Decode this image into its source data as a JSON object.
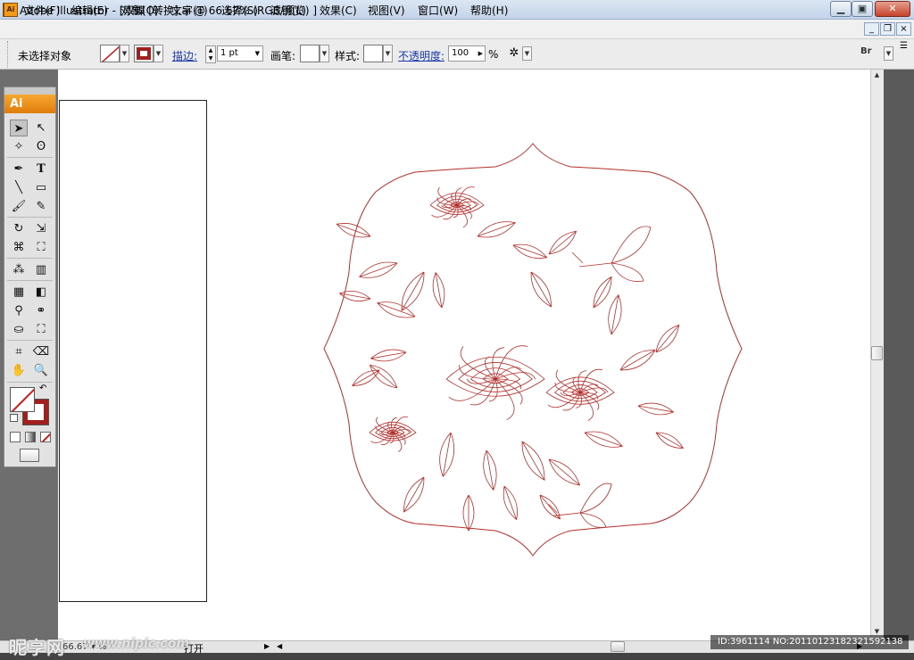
{
  "window": {
    "title": "Adobe Illustrator - [双蝶 [转换].ai @ 66.67% (RGB/预览) ]",
    "app_icon": "Ai",
    "min": "0",
    "max": "1",
    "close": "r"
  },
  "menu": {
    "icon": "Ai",
    "items": [
      "文件(F)",
      "编辑(E)",
      "对象(O)",
      "文字(T)",
      "选择(S)",
      "滤镜(L)",
      "效果(C)",
      "视图(V)",
      "窗口(W)",
      "帮助(H)"
    ],
    "doc_min": "_",
    "doc_restore": "❐",
    "doc_close": "×"
  },
  "control": {
    "no_selection": "未选择对象",
    "stroke_label": "描边:",
    "stroke_weight": "1 pt",
    "brush_label": "画笔:",
    "style_label": "样式:",
    "opacity_label": "不透明度:",
    "opacity_value": "100",
    "percent": "%",
    "stroke_color": "#a1201f"
  },
  "toolpanel": {
    "badge": "Ai"
  },
  "status": {
    "zoom": "66.67",
    "open_label": "打开"
  },
  "watermark": {
    "logo": "昵享网",
    "url": "www.nipic.com",
    "id": "ID:3961114 NO:20110123182321592138"
  },
  "colors": {
    "artwork": "#b3302c",
    "accent": "#f29b1a"
  }
}
